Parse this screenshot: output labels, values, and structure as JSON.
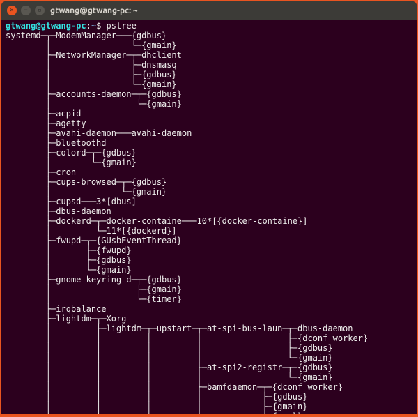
{
  "titlebar": {
    "title": "gtwang@gtwang-pc: ~"
  },
  "prompt": {
    "user_host": "gtwang@gtwang-pc",
    "sep": ":",
    "path": "~",
    "dollar": "$",
    "command": "pstree"
  },
  "tree": "systemd─┬─ModemManager───{gdbus}\n        │                └─{gmain}\n        ├─NetworkManager─┬─dhclient\n        │                ├─dnsmasq\n        │                ├─{gdbus}\n        │                └─{gmain}\n        ├─accounts-daemon─┬─{gdbus}\n        │                 └─{gmain}\n        ├─acpid\n        ├─agetty\n        ├─avahi-daemon───avahi-daemon\n        ├─bluetoothd\n        ├─colord─┬─{gdbus}\n        │        └─{gmain}\n        ├─cron\n        ├─cups-browsed─┬─{gdbus}\n        │              └─{gmain}\n        ├─cupsd───3*[dbus]\n        ├─dbus-daemon\n        ├─dockerd─┬─docker-containe───10*[{docker-containe}]\n        │         └─11*[{dockerd}]\n        ├─fwupd─┬─{GUsbEventThread}\n        │       ├─{fwupd}\n        │       ├─{gdbus}\n        │       └─{gmain}\n        ├─gnome-keyring-d─┬─{gdbus}\n        │                 ├─{gmain}\n        │                 └─{timer}\n        ├─irqbalance\n        ├─lightdm─┬─Xorg\n        │         ├─lightdm─┬─upstart─┬─at-spi-bus-laun─┬─dbus-daemon\n        │         │         │         │                 ├─{dconf worker}\n        │         │         │         │                 ├─{gdbus}\n        │         │         │         │                 └─{gmain}\n        │         │         │         ├─at-spi2-registr─┬─{gdbus}\n        │         │         │         │                 └─{gmain}\n        │         │         │         ├─bamfdaemon─┬─{dconf worker}\n        │         │         │         │            ├─{gdbus}\n        │         │         │         │            ├─{gmain}\n        │         │         │         │            └─{pool}"
}
